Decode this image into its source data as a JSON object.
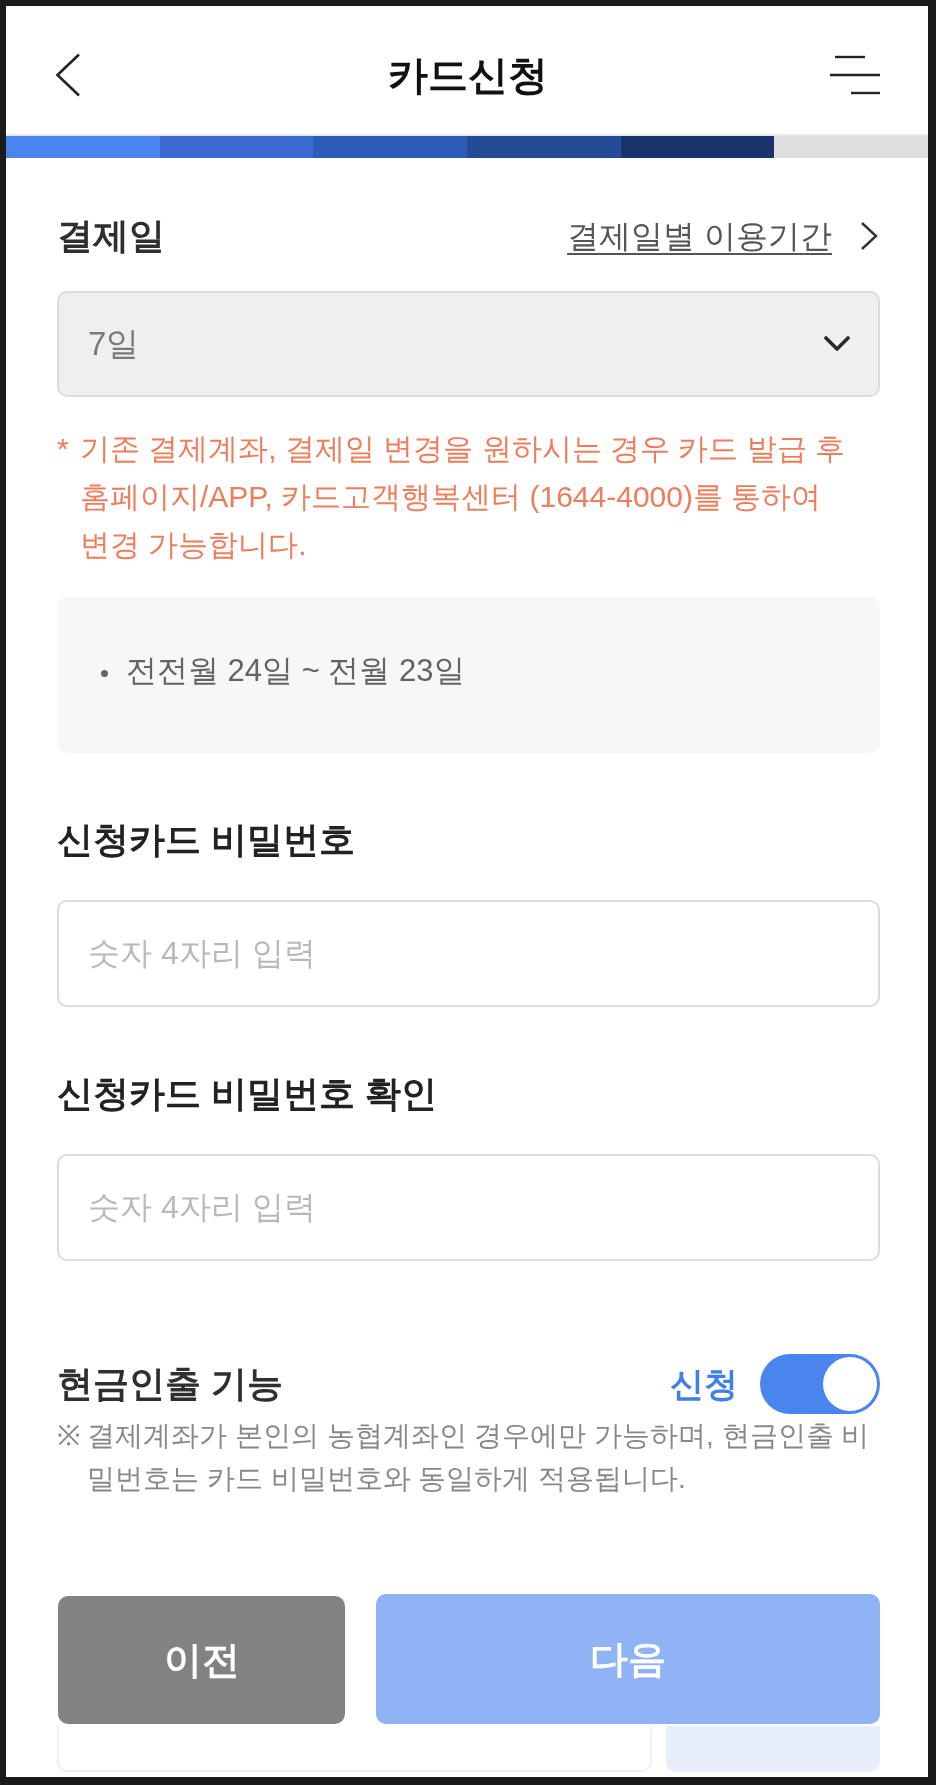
{
  "header": {
    "title": "카드신청"
  },
  "progress": {
    "steps": [
      {
        "done": true,
        "color": "#4a84ee"
      },
      {
        "done": true,
        "color": "#3a6bd0"
      },
      {
        "done": true,
        "color": "#2c5bb8"
      },
      {
        "done": true,
        "color": "#244c96"
      },
      {
        "done": true,
        "color": "#19346a"
      },
      {
        "done": false
      }
    ]
  },
  "payment_day": {
    "label": "결제일",
    "link": "결제일별 이용기간",
    "select": {
      "value": "7일"
    },
    "notice": {
      "mark": "*",
      "text": "기존 결제계좌, 결제일 변경을 원하시는 경우 카드 발급 후 홈페이지/APP, 카드고객행복센터 (1644-4000)를 통하여 변경 가능합니다."
    },
    "period_items": [
      "전전월 24일 ~ 전월 23일"
    ]
  },
  "password_fields": [
    {
      "label": "신청카드 비밀번호",
      "placeholder": "숫자 4자리 입력"
    },
    {
      "label": "신청카드 비밀번호 확인",
      "placeholder": "숫자 4자리 입력"
    }
  ],
  "cash_withdrawal": {
    "label": "현금인출 기능",
    "toggle_label": "신청",
    "on": true,
    "note": {
      "mark": "※",
      "text": "결제계좌가 본인의 농협계좌인 경우에만 가능하며, 현금인출 비밀번호는 카드 비밀번호와 동일하게 적용됩니다."
    }
  },
  "cash_pin": {
    "disabled": true
  },
  "footer_buttons": [
    {
      "label": "이전",
      "kind": "secondary",
      "disabled": false
    },
    {
      "label": "다음",
      "kind": "primary",
      "disabled": true
    }
  ]
}
